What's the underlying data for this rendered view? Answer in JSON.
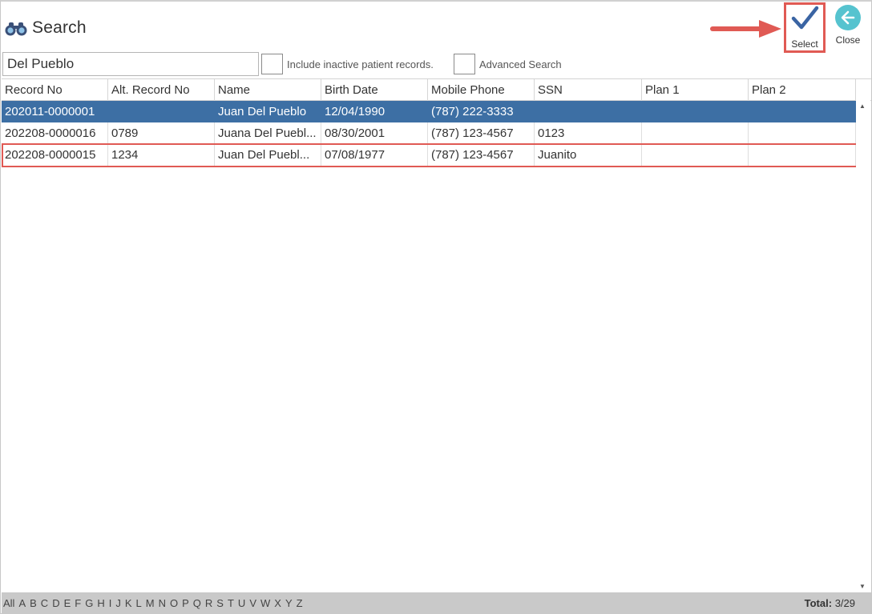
{
  "header": {
    "title": "Search"
  },
  "toolbar": {
    "select_label": "Select",
    "close_label": "Close"
  },
  "search": {
    "value": "Del Pueblo",
    "include_inactive_label": "Include inactive patient records.",
    "advanced_label": "Advanced Search"
  },
  "table": {
    "columns": [
      "Record No",
      "Alt. Record No",
      "Name",
      "Birth Date",
      "Mobile Phone",
      "SSN",
      "Plan 1",
      "Plan 2"
    ],
    "rows": [
      [
        "202011-0000001",
        "",
        "Juan Del Pueblo",
        "12/04/1990",
        "(787) 222-3333",
        "",
        "",
        ""
      ],
      [
        "202208-0000016",
        "0789",
        "Juana Del Puebl...",
        "08/30/2001",
        "(787) 123-4567",
        "0123",
        "",
        ""
      ],
      [
        "202208-0000015",
        "1234",
        "Juan Del Puebl...",
        "07/08/1977",
        "(787) 123-4567",
        "Juanito",
        "",
        ""
      ]
    ]
  },
  "footer": {
    "letters": [
      "All",
      "A",
      "B",
      "C",
      "D",
      "E",
      "F",
      "G",
      "H",
      "I",
      "J",
      "K",
      "L",
      "M",
      "N",
      "O",
      "P",
      "Q",
      "R",
      "S",
      "T",
      "U",
      "V",
      "W",
      "X",
      "Y",
      "Z"
    ],
    "total_label": "Total:",
    "total_value": "3/29"
  },
  "colors": {
    "selected_row": "#3d6fa4",
    "highlight": "#e05a54",
    "close_accent": "#56c3cf",
    "check_accent": "#3a64a3"
  },
  "icons": {
    "title": "binoculars-icon",
    "select": "checkmark-icon",
    "close": "arrow-left-icon"
  }
}
